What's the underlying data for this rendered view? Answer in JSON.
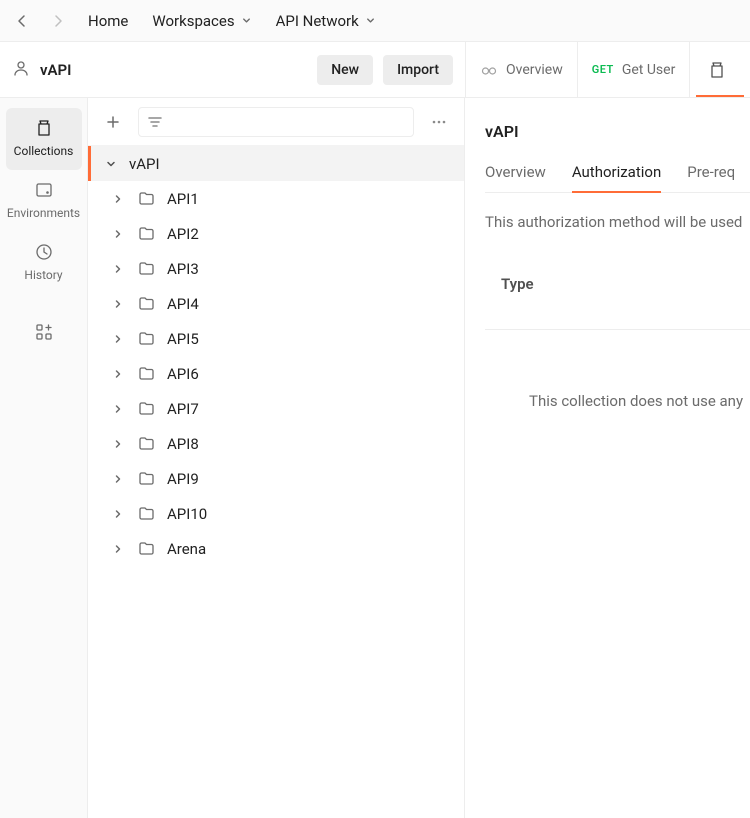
{
  "topbar": {
    "home": "Home",
    "workspaces": "Workspaces",
    "api_network": "API Network"
  },
  "workspace": {
    "name": "vAPI",
    "new_button": "New",
    "import_button": "Import"
  },
  "tabs": [
    {
      "type": "overview",
      "label": "Overview"
    },
    {
      "type": "request",
      "method": "GET",
      "label": "Get User"
    }
  ],
  "rail": {
    "collections": "Collections",
    "environments": "Environments",
    "history": "History"
  },
  "tree": {
    "root": "vAPI",
    "items": [
      "API1",
      "API2",
      "API3",
      "API4",
      "API5",
      "API6",
      "API7",
      "API8",
      "API9",
      "API10",
      "Arena"
    ]
  },
  "content": {
    "title": "vAPI",
    "tabs": {
      "overview": "Overview",
      "authorization": "Authorization",
      "prerequest": "Pre-req"
    },
    "desc": "This authorization method will be used",
    "type_label": "Type",
    "noauth_text": "This collection does not use any"
  }
}
